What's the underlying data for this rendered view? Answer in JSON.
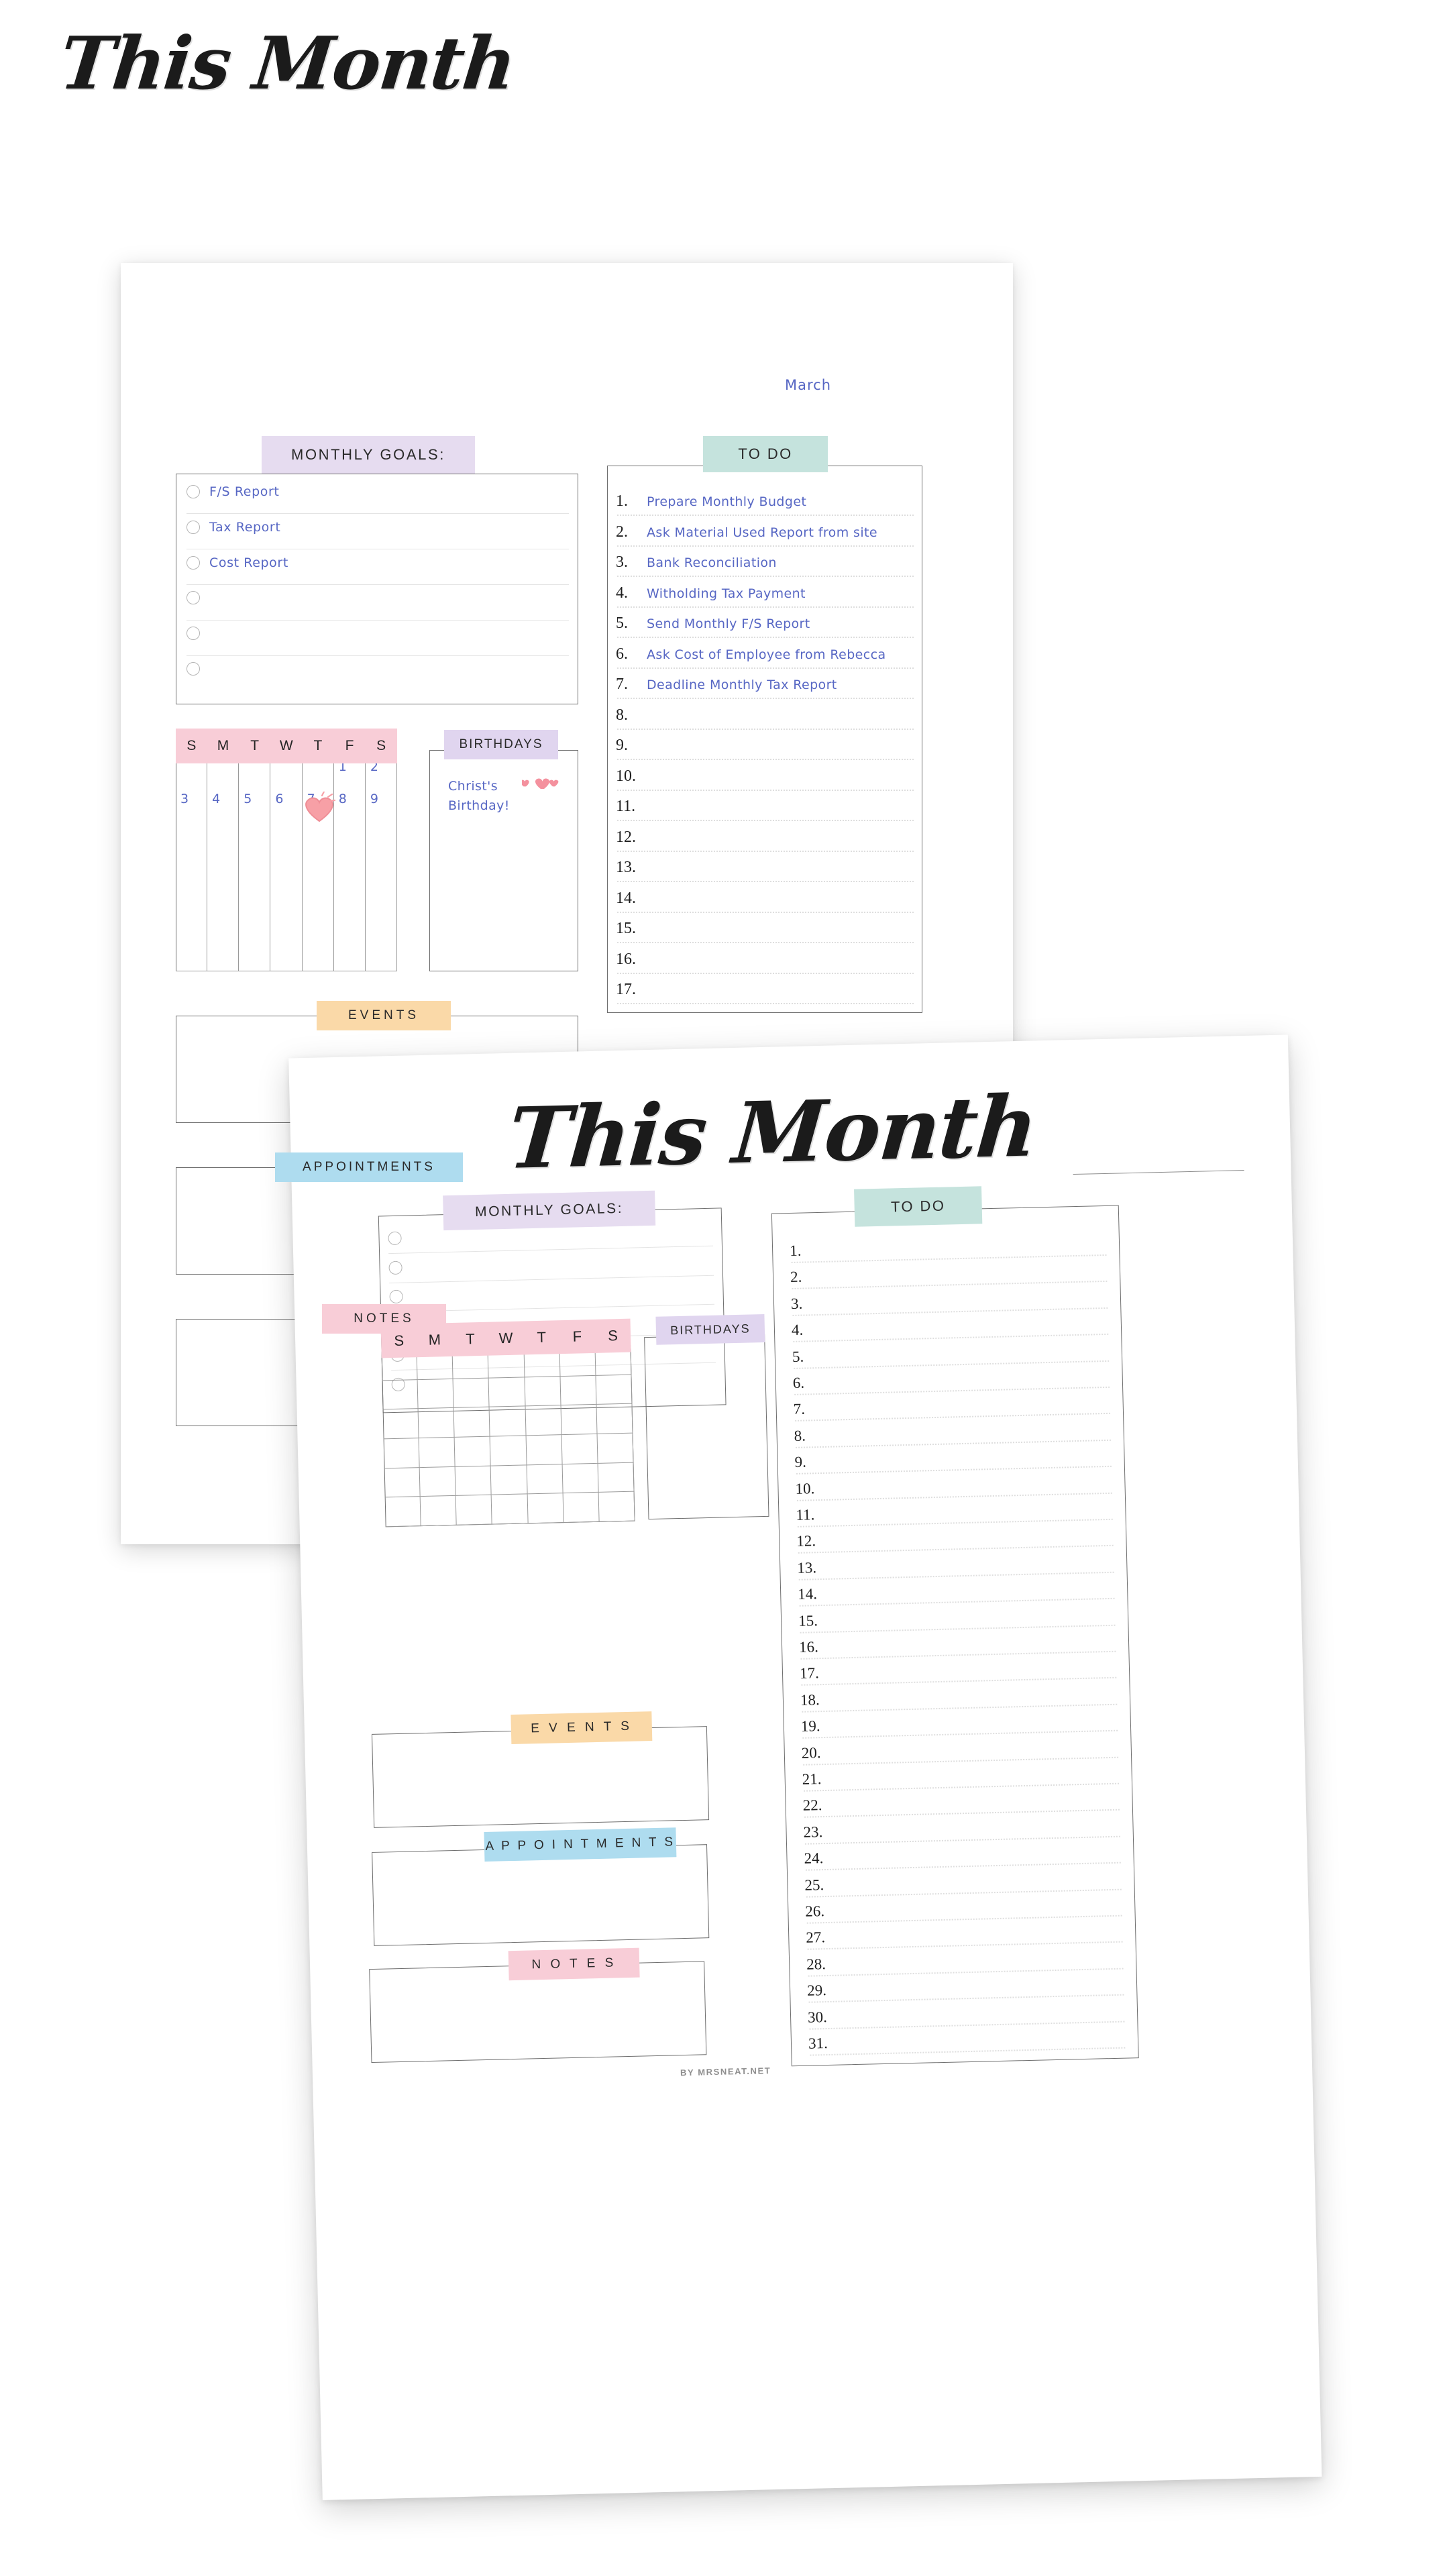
{
  "colors": {
    "lilac": "#e6dcf0",
    "mint": "#c5e3dd",
    "pink": "#f8cdd7",
    "peach": "#fad9a8",
    "blue": "#aedcef",
    "handwriting_blue": "#5767c4",
    "ink": "#1f1f1f"
  },
  "page_back": {
    "title": "This Month",
    "month": "March",
    "monthly_goals": {
      "label": "MONTHLY GOALS:",
      "items": [
        "F/S Report",
        "Tax Report",
        "Cost Report",
        "",
        "",
        ""
      ]
    },
    "todo": {
      "label": "TO DO",
      "items": [
        {
          "n": "1.",
          "text": "Prepare Monthly Budget"
        },
        {
          "n": "2.",
          "text": "Ask Material Used Report from site"
        },
        {
          "n": "3.",
          "text": "Bank Reconciliation"
        },
        {
          "n": "4.",
          "text": "Witholding Tax Payment"
        },
        {
          "n": "5.",
          "text": "Send Monthly F/S Report"
        },
        {
          "n": "6.",
          "text": "Ask Cost of Employee from Rebecca"
        },
        {
          "n": "7.",
          "text": "Deadline Monthly Tax Report"
        },
        {
          "n": "8.",
          "text": ""
        },
        {
          "n": "9.",
          "text": ""
        },
        {
          "n": "10.",
          "text": ""
        },
        {
          "n": "11.",
          "text": ""
        },
        {
          "n": "12.",
          "text": ""
        },
        {
          "n": "13.",
          "text": ""
        },
        {
          "n": "14.",
          "text": ""
        },
        {
          "n": "15.",
          "text": ""
        },
        {
          "n": "16.",
          "text": ""
        },
        {
          "n": "17.",
          "text": ""
        }
      ]
    },
    "calendar": {
      "weekdays": [
        "S",
        "M",
        "T",
        "W",
        "T",
        "F",
        "S"
      ],
      "days_row1": [
        "",
        "",
        "",
        "",
        "",
        "1",
        "2"
      ],
      "days_row2": [
        "3",
        "4",
        "5",
        "6",
        "7",
        "8",
        "9"
      ],
      "marked_day": "7"
    },
    "birthdays": {
      "label": "BIRTHDAYS",
      "entry_line1": "Christ's",
      "entry_line2": "Birthday!"
    },
    "events": {
      "label": "EVENTS"
    },
    "appointments": {
      "label": "APPOINTMENTS"
    },
    "notes": {
      "label": "NOTES"
    }
  },
  "page_front": {
    "title": "This Month",
    "monthly_goals": {
      "label": "MONTHLY GOALS:",
      "items": [
        "",
        "",
        "",
        "",
        "",
        ""
      ]
    },
    "todo": {
      "label": "TO DO",
      "items": [
        "1.",
        "2.",
        "3.",
        "4.",
        "5.",
        "6.",
        "7.",
        "8.",
        "9.",
        "10.",
        "11.",
        "12.",
        "13.",
        "14.",
        "15.",
        "16.",
        "17.",
        "18.",
        "19.",
        "20.",
        "21.",
        "22.",
        "23.",
        "24.",
        "25.",
        "26.",
        "27.",
        "28.",
        "29.",
        "30.",
        "31."
      ]
    },
    "calendar": {
      "weekdays": [
        "S",
        "M",
        "T",
        "W",
        "T",
        "F",
        "S"
      ],
      "rows": 6,
      "cols": 7
    },
    "birthdays": {
      "label": "BIRTHDAYS"
    },
    "events": {
      "label": "E V E N T S"
    },
    "appointments": {
      "label": "A P P O I N T M E N T S"
    },
    "notes": {
      "label": "N O T E S"
    },
    "footer": "BY  MRSNEAT.NET"
  }
}
